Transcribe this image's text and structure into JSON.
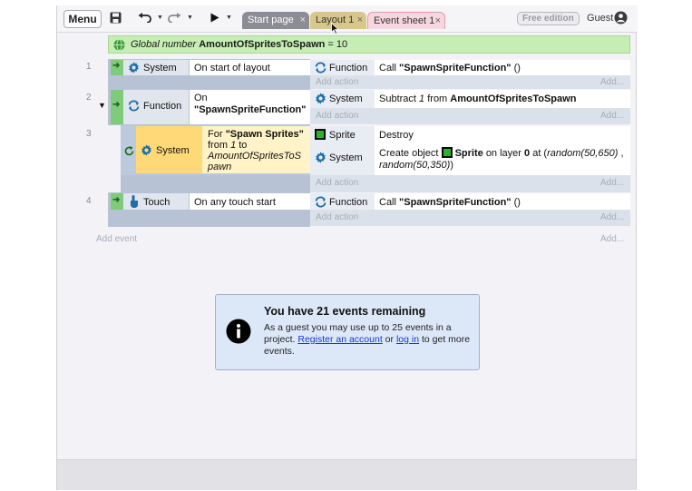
{
  "toolbar": {
    "menu_label": "Menu",
    "save_icon": "save-icon",
    "undo_icon": "undo-icon",
    "redo_icon": "redo-icon",
    "play_icon": "play-icon",
    "tabs": [
      {
        "label": "Start page",
        "state": "inactive"
      },
      {
        "label": "Layout 1",
        "state": "inactive"
      },
      {
        "label": "Event sheet 1",
        "state": "active"
      }
    ],
    "edition_badge": "Free edition",
    "user_label": "Guest"
  },
  "global_variable": {
    "prefix": "Global number",
    "name": "AmountOfSpritesToSpawn",
    "equals": "= 10"
  },
  "events": [
    {
      "number": "1",
      "conditions": [
        {
          "object": "System",
          "icon": "gear-icon",
          "text": "On start of layout"
        }
      ],
      "actions": [
        {
          "object": "Function",
          "icon": "function-icon",
          "prefix": "Call",
          "value": "\"SpawnSpriteFunction\"",
          "suffix": "()"
        }
      ]
    },
    {
      "number": "2",
      "conditions": [
        {
          "object": "Function",
          "icon": "function-icon",
          "line1": "On",
          "line2": "\"SpawnSpriteFunction\""
        }
      ],
      "actions": [
        {
          "object": "System",
          "icon": "gear-icon",
          "prefix": "Subtract",
          "value": "1",
          "middle": "from",
          "target": "AmountOfSpritesToSpawn"
        }
      ]
    },
    {
      "number": "3",
      "conditions": [
        {
          "object": "System",
          "icon": "gear-icon",
          "line1_prefix": "For",
          "line1_value": "\"Spawn Sprites\"",
          "line2": "from",
          "line2_value": "1",
          "line2_suffix": "to",
          "line3": "AmountOfSpritesToS",
          "line4": "pawn"
        }
      ],
      "actions": [
        {
          "object": "Sprite",
          "icon": "sprite-icon",
          "text": "Destroy"
        },
        {
          "object": "System",
          "icon": "gear-icon",
          "prefix": "Create object",
          "sprite": "Sprite",
          "on_layer": "on layer",
          "layer": "0",
          "at": "at (",
          "x_expr": "random(50,650)",
          "comma": ",",
          "y_expr": "random(50,350)",
          "close": ")"
        }
      ]
    },
    {
      "number": "4",
      "conditions": [
        {
          "object": "Touch",
          "icon": "touch-icon",
          "text": "On any touch start"
        }
      ],
      "actions": [
        {
          "object": "Function",
          "icon": "function-icon",
          "prefix": "Call",
          "value": "\"SpawnSpriteFunction\"",
          "suffix": "()"
        }
      ]
    }
  ],
  "add_action_label": "Add action",
  "add_label": "Add...",
  "add_event_label": "Add event",
  "notice": {
    "title": "You have 21 events remaining",
    "text1": "As a guest you may use up to 25 events in a project.",
    "link1": "Register an account",
    "text2": "or",
    "link2": "log in",
    "text3": "to get more events."
  },
  "colors": {
    "global_var_bg": "#c5edb4",
    "event_band": "#b7c3d5",
    "selected_condition": "#ffd978",
    "active_tab": "#f7d7df",
    "notice_bg": "#dce8f8",
    "link": "#1a35d6"
  }
}
